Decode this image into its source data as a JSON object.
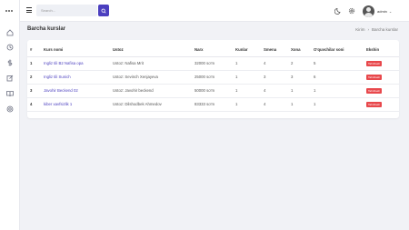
{
  "header": {
    "search_placeholder": "Search...",
    "username": "admin"
  },
  "page": {
    "title": "Barcha kurslar",
    "breadcrumb": [
      "Kirim",
      "Barcha kurslar"
    ]
  },
  "table": {
    "columns": [
      "#",
      "Kurs nomi",
      "Ustoz",
      "Narx",
      "Kunlar",
      "Smena",
      "Xona",
      "O'quvchilar soni",
      "Ekshin"
    ],
    "rows": [
      {
        "n": "1",
        "name": "Ingliz tili B2 Nafisa opa",
        "teacher": "Ustoz: Nafisa Mrit",
        "price": "32000 so'm",
        "days": "1",
        "shift": "4",
        "room": "2",
        "students": "5",
        "action": "Tahrirlash"
      },
      {
        "n": "2",
        "name": "Ingliz tili Sunich",
        "teacher": "Ustoz: Sevinch Xenjayeva",
        "price": "25000 so'm",
        "days": "1",
        "shift": "3",
        "room": "3",
        "students": "6",
        "action": "Tahrirlash"
      },
      {
        "n": "3",
        "name": "Javohir Beckend 02",
        "teacher": "Ustoz: Javohir beckend",
        "price": "50000 so'm",
        "days": "1",
        "shift": "4",
        "room": "1",
        "students": "1",
        "action": "Tahrirlash"
      },
      {
        "n": "4",
        "name": "kiber xavfsizlik 1",
        "teacher": "Ustoz: Dilshodbek Ahmedov",
        "price": "83333 so'm",
        "days": "1",
        "shift": "4",
        "room": "1",
        "students": "1",
        "action": "Tahrirlash"
      }
    ]
  },
  "icons": {
    "sidebar": [
      "home-icon",
      "clock-icon",
      "dollar-icon",
      "edit-icon",
      "book-icon",
      "target-icon"
    ],
    "top": [
      "moon-icon",
      "settings-icon"
    ]
  },
  "colors": {
    "accent": "#4b3fbf",
    "danger": "#e8484c"
  }
}
